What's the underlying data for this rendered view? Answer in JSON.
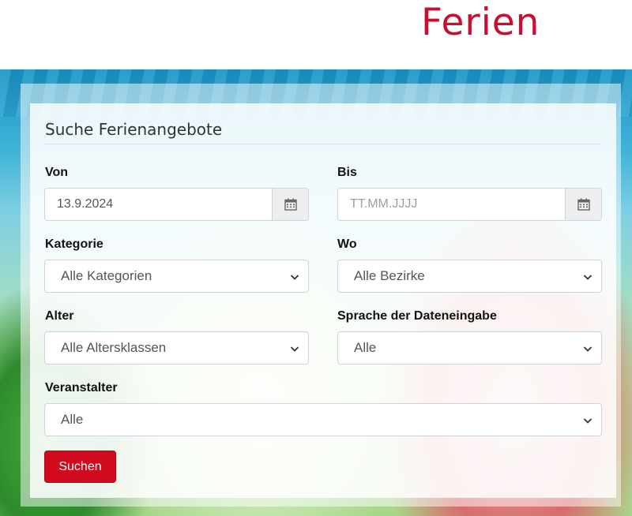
{
  "header": {
    "brand": "Ferien"
  },
  "form": {
    "title": "Suche Ferienangebote",
    "von": {
      "label": "Von",
      "value": "13.9.2024",
      "placeholder": ""
    },
    "bis": {
      "label": "Bis",
      "value": "",
      "placeholder": "TT.MM.JJJJ"
    },
    "kategorie": {
      "label": "Kategorie",
      "selected": "Alle Kategorien"
    },
    "wo": {
      "label": "Wo",
      "selected": "Alle Bezirke"
    },
    "alter": {
      "label": "Alter",
      "selected": "Alle Altersklassen"
    },
    "sprache": {
      "label": "Sprache der Dateneingabe",
      "selected": "Alle"
    },
    "veranstalter": {
      "label": "Veranstalter",
      "selected": "Alle"
    },
    "submit_label": "Suchen"
  },
  "icons": {
    "calendar": "calendar-icon",
    "dropdown": "chevron-down-icon"
  },
  "colors": {
    "brand": "#c8102e",
    "button": "#d10a1e"
  }
}
